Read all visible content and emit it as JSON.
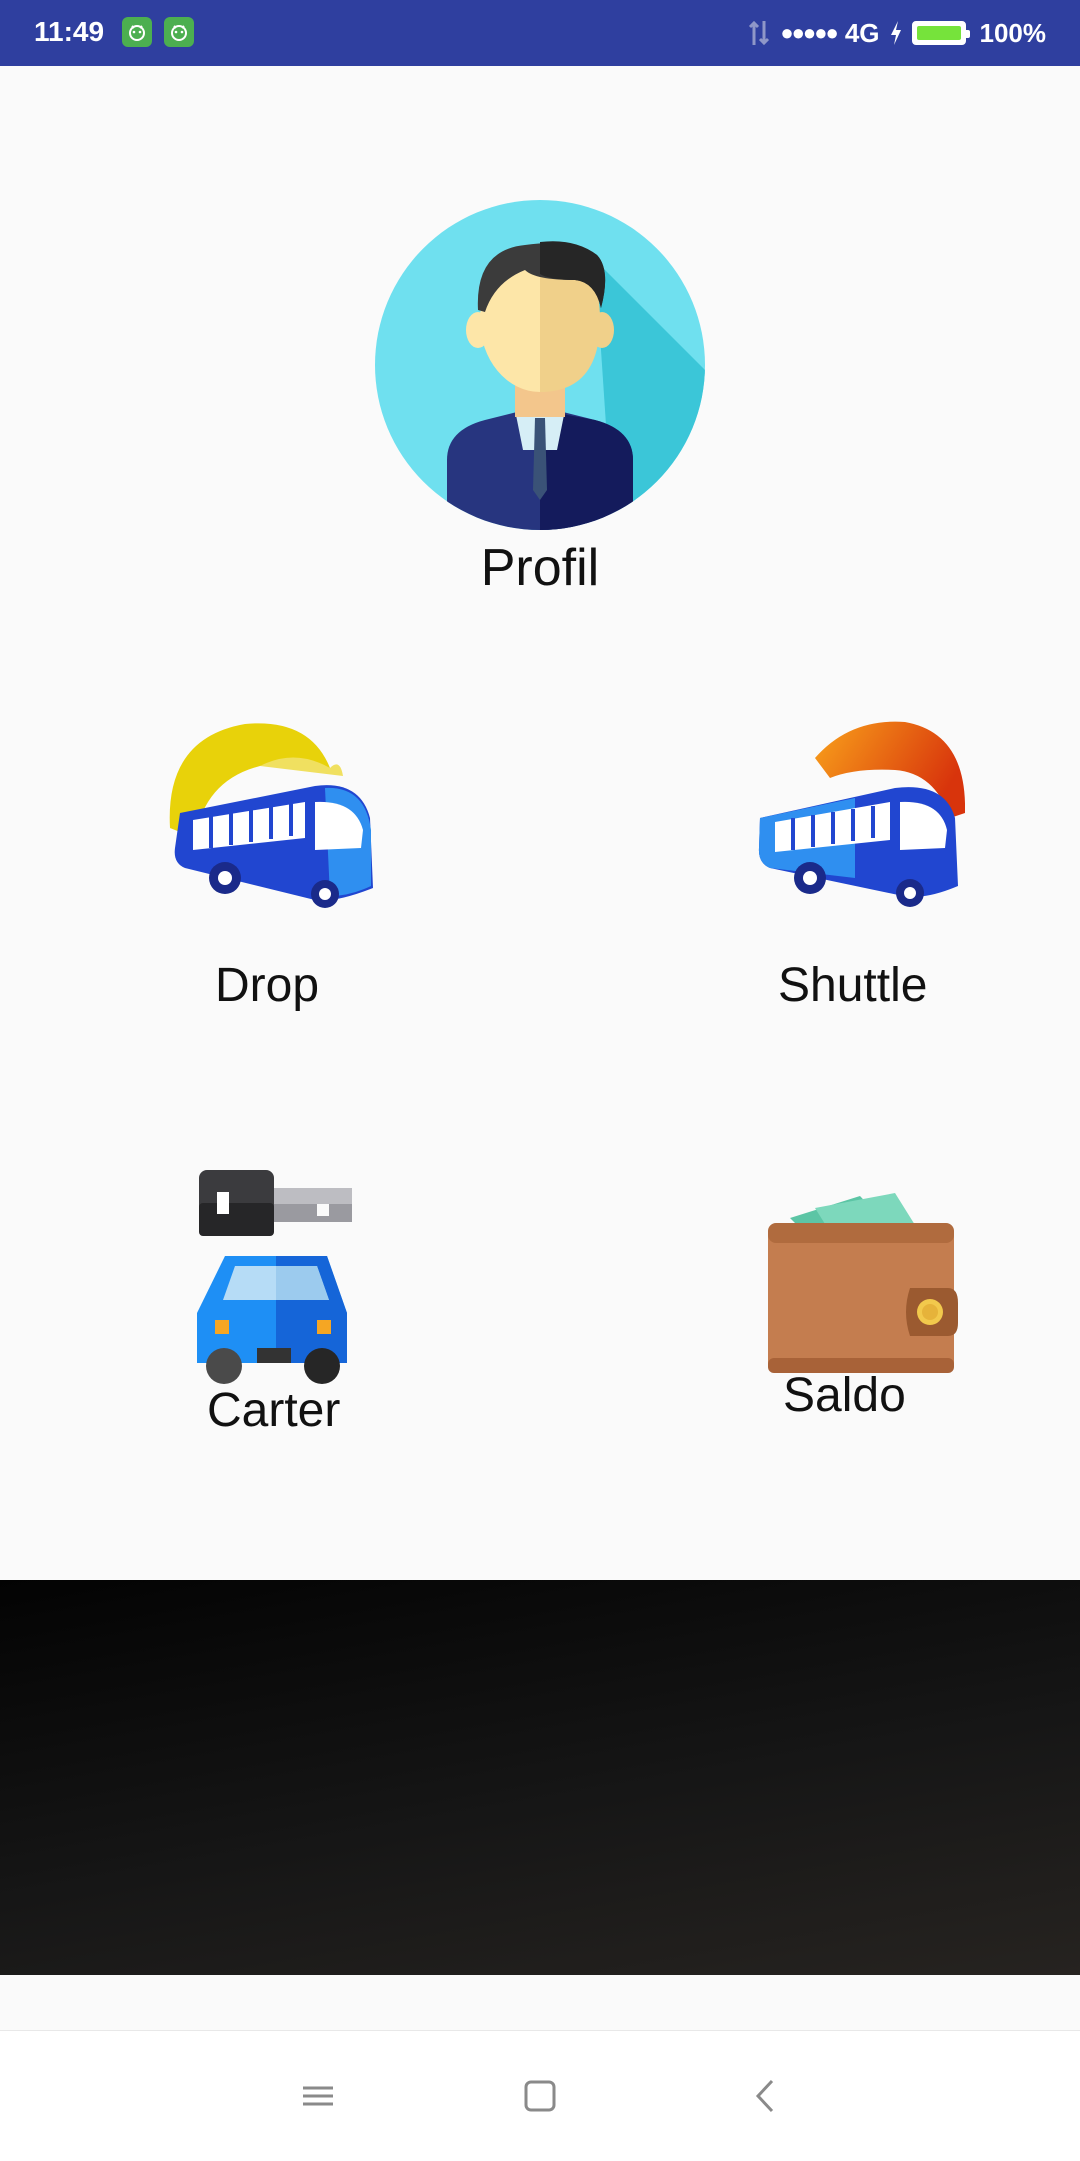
{
  "status_bar": {
    "time": "11:49",
    "network": "4G",
    "signal_dots": "●●●●●",
    "battery": "100%",
    "battery_color": "#76e33b",
    "notification_icons": [
      "android-app-icon",
      "android-app-icon"
    ]
  },
  "menu": {
    "profil": {
      "label": "Profil",
      "icon": "user-avatar-icon"
    },
    "drop": {
      "label": "Drop",
      "icon": "bus-yellow-sun-icon"
    },
    "shuttle": {
      "label": "Shuttle",
      "icon": "bus-orange-sun-icon"
    },
    "carter": {
      "label": "Carter",
      "icon": "car-key-icon"
    },
    "saldo": {
      "label": "Saldo",
      "icon": "wallet-icon"
    }
  },
  "nav_bar": {
    "buttons": [
      "menu-icon",
      "home-icon",
      "back-icon"
    ]
  },
  "colors": {
    "status_bar": "#2f3f9f",
    "background": "#fafafa",
    "bus_blue": "#1e3fd6"
  }
}
